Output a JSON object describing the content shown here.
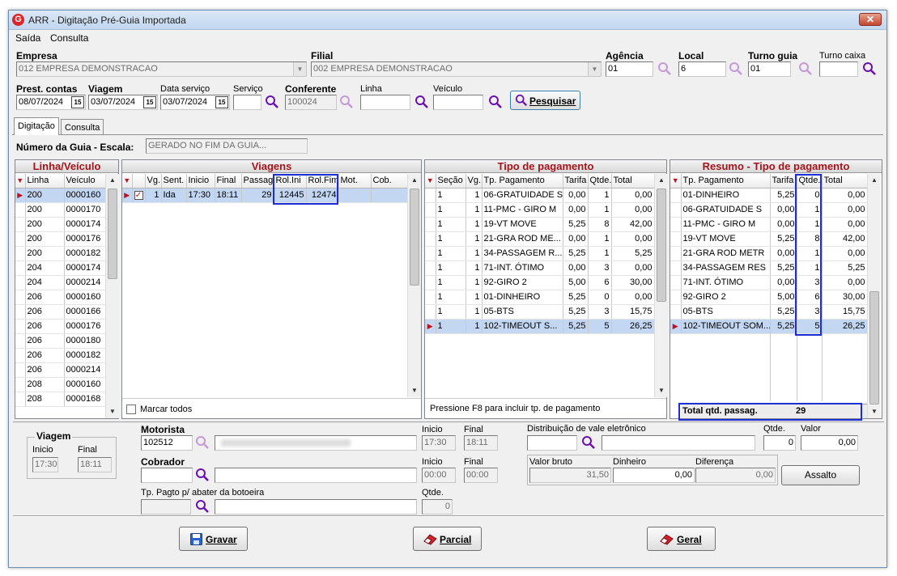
{
  "window": {
    "title": "ARR - Digitação Pré-Guia Importada",
    "close": "✕"
  },
  "menu": {
    "saida": "Saída",
    "consulta": "Consulta"
  },
  "header": {
    "empresa_label": "Empresa",
    "empresa_value": "012 EMPRESA DEMONSTRACAO",
    "filial_label": "Filial",
    "filial_value": "002 EMPRESA DEMONSTRACAO",
    "agencia_label": "Agência",
    "agencia_value": "01",
    "local_label": "Local",
    "local_value": "6",
    "turno_guia_label": "Turno guia",
    "turno_guia_value": "01",
    "turno_caixa_label": "Turno caixa",
    "turno_caixa_value": "",
    "prest_label": "Prest. contas",
    "prest_value": "08/07/2024",
    "viagem_label": "Viagem",
    "viagem_value": "03/07/2024",
    "data_servico_label": "Data serviço",
    "data_servico_value": "03/07/2024",
    "servico_label": "Serviço",
    "servico_value": "",
    "conferente_label": "Conferente",
    "conferente_value": "100024",
    "linha_label": "Linha",
    "linha_value": "",
    "veiculo_label": "Veículo",
    "veiculo_value": "",
    "pesquisar": "Pesquisar",
    "cal_glyph": "15"
  },
  "tabs": {
    "digitacao": "Digitação",
    "consulta": "Consulta"
  },
  "guia": {
    "label": "Número da Guia - Escala:",
    "value": "GERADO NO FIM DA GUIA..."
  },
  "linha_veiculo": {
    "title": "Linha/Veículo",
    "columns": [
      "Linha",
      "Veículo"
    ],
    "rows": [
      [
        "200",
        "0000160"
      ],
      [
        "200",
        "0000170"
      ],
      [
        "200",
        "0000174"
      ],
      [
        "200",
        "0000176"
      ],
      [
        "200",
        "0000182"
      ],
      [
        "204",
        "0000174"
      ],
      [
        "204",
        "0000214"
      ],
      [
        "206",
        "0000160"
      ],
      [
        "206",
        "0000166"
      ],
      [
        "206",
        "0000176"
      ],
      [
        "206",
        "0000180"
      ],
      [
        "206",
        "0000182"
      ],
      [
        "206",
        "0000214"
      ],
      [
        "208",
        "0000160"
      ],
      [
        "208",
        "0000168"
      ]
    ]
  },
  "viagens": {
    "title": "Viagens",
    "columns": [
      "Vg.",
      "Sent.",
      "Inicio",
      "Final",
      "Passag.",
      "Rol.Ini",
      "Rol.Fim",
      "Mot.",
      "Cob."
    ],
    "rows": [
      [
        "1",
        "Ida",
        "17:30",
        "18:11",
        "29",
        "12445",
        "12474",
        "",
        ""
      ]
    ],
    "checked": true,
    "marcar_todos": "Marcar todos"
  },
  "tipo_pagamento": {
    "title": "Tipo de pagamento",
    "columns": [
      "Seção",
      "Vg.",
      "Tp. Pagamento",
      "Tarifa",
      "Qtde.",
      "Total"
    ],
    "rows": [
      [
        "1",
        "1",
        "06-GRATUIDADE S",
        "0,00",
        "1",
        "0,00"
      ],
      [
        "1",
        "1",
        "11-PMC - GIRO M",
        "0,00",
        "1",
        "0,00"
      ],
      [
        "1",
        "1",
        "19-VT MOVE",
        "5,25",
        "8",
        "42,00"
      ],
      [
        "1",
        "1",
        "21-GRA ROD ME...",
        "0,00",
        "1",
        "0,00"
      ],
      [
        "1",
        "1",
        "34-PASSAGEM R...",
        "5,25",
        "1",
        "5,25"
      ],
      [
        "1",
        "1",
        "71-INT. ÓTIMO",
        "0,00",
        "3",
        "0,00"
      ],
      [
        "1",
        "1",
        "92-GIRO 2",
        "5,00",
        "6",
        "30,00"
      ],
      [
        "1",
        "1",
        "01-DINHEIRO",
        "5,25",
        "0",
        "0,00"
      ],
      [
        "1",
        "1",
        "05-BTS",
        "5,25",
        "3",
        "15,75"
      ],
      [
        "1",
        "1",
        "102-TIMEOUT S...",
        "5,25",
        "5",
        "26,25"
      ]
    ],
    "hint": "Pressione F8 para incluir tp. de pagamento"
  },
  "resumo": {
    "title": "Resumo - Tipo de pagamento",
    "columns": [
      "Tp. Pagamento",
      "Tarifa",
      "Qtde.",
      "Total"
    ],
    "rows": [
      [
        "01-DINHEIRO",
        "5,25",
        "0",
        "0,00"
      ],
      [
        "06-GRATUIDADE S",
        "0,00",
        "1",
        "0,00"
      ],
      [
        "11-PMC - GIRO M",
        "0,00",
        "1",
        "0,00"
      ],
      [
        "19-VT MOVE",
        "5,25",
        "8",
        "42,00"
      ],
      [
        "21-GRA ROD METR",
        "0,00",
        "1",
        "0,00"
      ],
      [
        "34-PASSAGEM RES",
        "5,25",
        "1",
        "5,25"
      ],
      [
        "71-INT. ÓTIMO",
        "0,00",
        "3",
        "0,00"
      ],
      [
        "92-GIRO 2",
        "5,00",
        "6",
        "30,00"
      ],
      [
        "05-BTS",
        "5,25",
        "3",
        "15,75"
      ],
      [
        "102-TIMEOUT SOM...",
        "5,25",
        "5",
        "26,25"
      ]
    ],
    "total_label": "Total qtd. passag.",
    "total_value": "29"
  },
  "bottom": {
    "viagem_group": "Viagem",
    "inicio_label": "Inicio",
    "inicio_value": "17:30",
    "final_label": "Final",
    "final_value": "18:11",
    "motorista_label": "Motorista",
    "motorista_code": "102512",
    "motorista_name": "",
    "mot_inicio_label": "Inicio",
    "mot_inicio_value": "17:30",
    "mot_final_label": "Final",
    "mot_final_value": "18:11",
    "cobrador_label": "Cobrador",
    "cobrador_code": "",
    "cobrador_name": "",
    "cob_inicio_label": "Inicio",
    "cob_inicio_value": "00:00",
    "cob_final_label": "Final",
    "cob_final_value": "00:00",
    "tp_pagto_label": "Tp. Pagto p/ abater da botoeira",
    "tp_pagto_value": "",
    "qtde_label": "Qtde.",
    "qtde_value": "0",
    "dist_label": "Distribuição de vale eletrônico",
    "dist_code": "",
    "dist_name": "",
    "dist_qtde_label": "Qtde.",
    "dist_qtde_value": "0",
    "dist_valor_label": "Valor",
    "dist_valor_value": "0,00",
    "valor_bruto_label": "Valor bruto",
    "valor_bruto_value": "31,50",
    "dinheiro_label": "Dinheiro",
    "dinheiro_value": "0,00",
    "diferenca_label": "Diferença",
    "diferenca_value": "0,00",
    "assalto": "Assalto"
  },
  "actions": {
    "gravar": "Gravar",
    "parcial": "Parcial",
    "geral": "Geral"
  }
}
